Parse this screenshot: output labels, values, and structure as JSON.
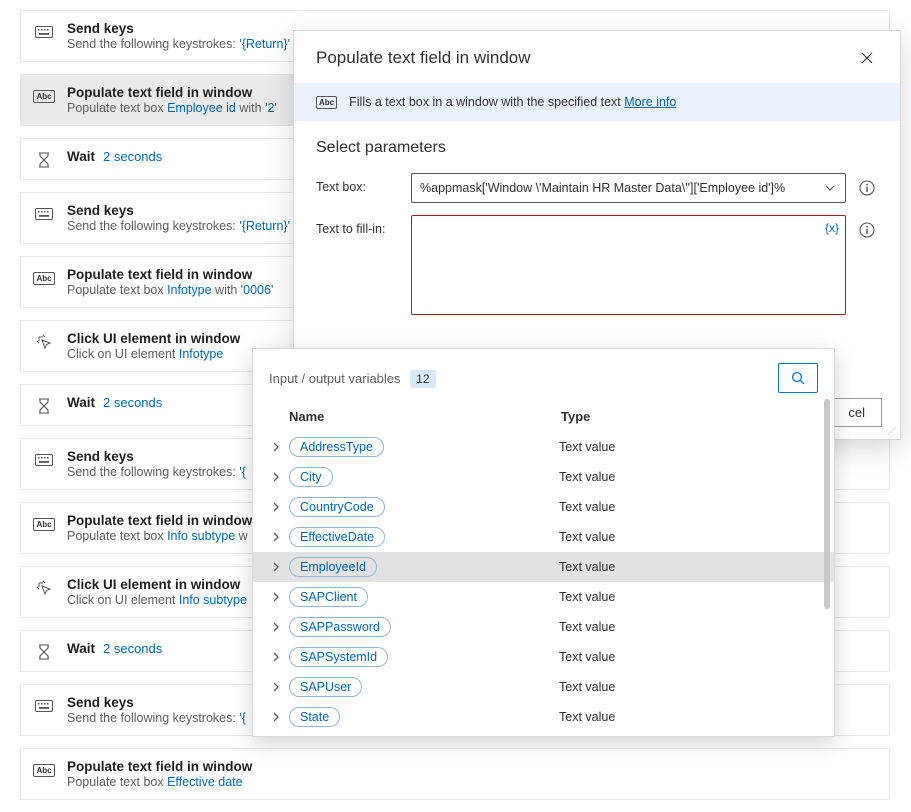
{
  "actions": [
    {
      "icon": "keyboard",
      "title": "Send keys",
      "descPrefix": "Send the following keystrokes: ",
      "link1": "'{Return}'"
    },
    {
      "icon": "abc",
      "title": "Populate text field in window",
      "descPrefix": "Populate text box ",
      "link1": "Employee id",
      "mid": " with ",
      "link2": "'2'",
      "selected": true
    },
    {
      "icon": "wait",
      "title": "Wait",
      "waitValue": "2 seconds",
      "isWait": true
    },
    {
      "icon": "keyboard",
      "title": "Send keys",
      "descPrefix": "Send the following keystrokes: ",
      "link1": "'{Return}'"
    },
    {
      "icon": "abc",
      "title": "Populate text field in window",
      "descPrefix": "Populate text box ",
      "link1": "Infotype",
      "mid": " with ",
      "link2": "'0006'"
    },
    {
      "icon": "click",
      "title": "Click UI element in window",
      "descPrefix": "Click on UI element ",
      "link1": "Infotype"
    },
    {
      "icon": "wait",
      "title": "Wait",
      "waitValue": "2 seconds",
      "isWait": true
    },
    {
      "icon": "keyboard",
      "title": "Send keys",
      "descPrefix": "Send the following keystrokes: ",
      "link1": "'{"
    },
    {
      "icon": "abc",
      "title": "Populate text field in window",
      "descPrefix": "Populate text box ",
      "link1": "Info subtype",
      "mid": " w"
    },
    {
      "icon": "click",
      "title": "Click UI element in window",
      "descPrefix": "Click on UI element ",
      "link1": "Info subtype"
    },
    {
      "icon": "wait",
      "title": "Wait",
      "waitValue": "2 seconds",
      "isWait": true
    },
    {
      "icon": "keyboard",
      "title": "Send keys",
      "descPrefix": "Send the following keystrokes: ",
      "link1": "'{"
    },
    {
      "icon": "abc",
      "title": "Populate text field in window",
      "descPrefix": "Populate text box ",
      "link1": "Effective date",
      "mid": " "
    }
  ],
  "dialog": {
    "title": "Populate text field in window",
    "bannerText": "Fills a text box in a window with the specified text ",
    "moreInfo": "More info",
    "sectionTitle": "Select parameters",
    "paramTextBoxLabel": "Text box:",
    "paramTextBoxValue": "%appmask['Window \\'Maintain HR Master Data\\'']['Employee id']%",
    "paramTextToFillLabel": "Text to fill-in:",
    "fx": "{x}",
    "cancel": "cel"
  },
  "popover": {
    "ioLabel": "Input / output variables",
    "count": "12",
    "nameHeader": "Name",
    "typeHeader": "Type",
    "variables": [
      {
        "name": "AddressType",
        "type": "Text value"
      },
      {
        "name": "City",
        "type": "Text value"
      },
      {
        "name": "CountryCode",
        "type": "Text value"
      },
      {
        "name": "EffectiveDate",
        "type": "Text value"
      },
      {
        "name": "EmployeeId",
        "type": "Text value",
        "hover": true
      },
      {
        "name": "SAPClient",
        "type": "Text value"
      },
      {
        "name": "SAPPassword",
        "type": "Text value"
      },
      {
        "name": "SAPSystemId",
        "type": "Text value"
      },
      {
        "name": "SAPUser",
        "type": "Text value"
      },
      {
        "name": "State",
        "type": "Text value"
      }
    ]
  }
}
